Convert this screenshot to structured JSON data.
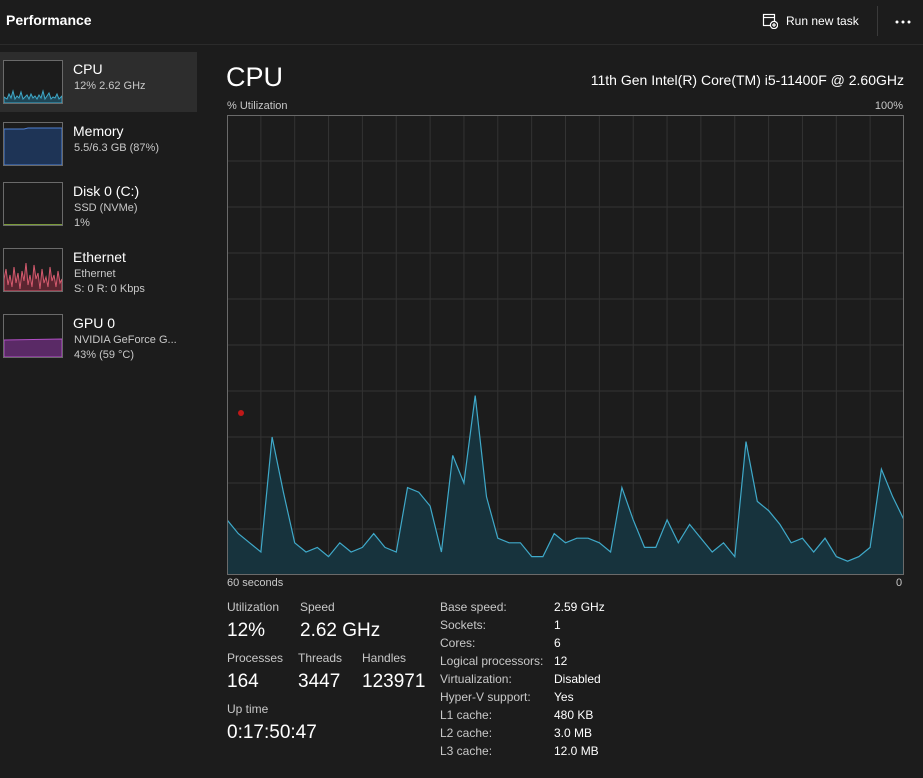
{
  "header": {
    "title": "Performance",
    "run_new_task": "Run new task",
    "more_icon": "ellipsis-icon"
  },
  "sidebar": {
    "items": [
      {
        "name": "CPU",
        "sub1": "12% 2.62 GHz",
        "sub2": "",
        "color": "#3fa9c9"
      },
      {
        "name": "Memory",
        "sub1": "5.5/6.3 GB (87%)",
        "sub2": "",
        "color": "#4f7fd1"
      },
      {
        "name": "Disk 0 (C:)",
        "sub1": "SSD (NVMe)",
        "sub2": "1%",
        "color": "#7a9a3a"
      },
      {
        "name": "Ethernet",
        "sub1": "Ethernet",
        "sub2": "S: 0 R: 0 Kbps",
        "color": "#d45a6e"
      },
      {
        "name": "GPU 0",
        "sub1": "NVIDIA GeForce G...",
        "sub2": "43% (59 °C)",
        "color": "#b04fc4"
      }
    ]
  },
  "main": {
    "title": "CPU",
    "model": "11th Gen Intel(R) Core(TM) i5-11400F @ 2.60GHz",
    "util_label": "% Utilization",
    "util_max": "100%",
    "time_left": "60 seconds",
    "time_right": "0",
    "accent": "#3fa9c9"
  },
  "stats": {
    "utilization_label": "Utilization",
    "utilization": "12%",
    "speed_label": "Speed",
    "speed": "2.62 GHz",
    "processes_label": "Processes",
    "processes": "164",
    "threads_label": "Threads",
    "threads": "3447",
    "handles_label": "Handles",
    "handles": "123971",
    "uptime_label": "Up time",
    "uptime": "0:17:50:47"
  },
  "specs": [
    {
      "label": "Base speed:",
      "value": "2.59 GHz"
    },
    {
      "label": "Sockets:",
      "value": "1"
    },
    {
      "label": "Cores:",
      "value": "6"
    },
    {
      "label": "Logical processors:",
      "value": "12"
    },
    {
      "label": "Virtualization:",
      "value": "Disabled"
    },
    {
      "label": "Hyper-V support:",
      "value": "Yes"
    },
    {
      "label": "L1 cache:",
      "value": "480 KB"
    },
    {
      "label": "L2 cache:",
      "value": "3.0 MB"
    },
    {
      "label": "L3 cache:",
      "value": "12.0 MB"
    }
  ],
  "chart_data": {
    "type": "area",
    "xlim": [
      60,
      0
    ],
    "ylim": [
      0,
      100
    ],
    "x": [
      60,
      59,
      58,
      57,
      56,
      55,
      54,
      53,
      52,
      51,
      50,
      49,
      48,
      47,
      46,
      45,
      44,
      43,
      42,
      41,
      40,
      39,
      38,
      37,
      36,
      35,
      34,
      33,
      32,
      31,
      30,
      29,
      28,
      27,
      26,
      25,
      24,
      23,
      22,
      21,
      20,
      19,
      18,
      17,
      16,
      15,
      14,
      13,
      12,
      11,
      10,
      9,
      8,
      7,
      6,
      5,
      4,
      3,
      2,
      1,
      0
    ],
    "values": [
      12,
      9,
      7,
      5,
      30,
      18,
      7,
      5,
      6,
      4,
      7,
      5,
      6,
      9,
      6,
      5,
      19,
      18,
      15,
      5,
      26,
      20,
      39,
      17,
      8,
      7,
      7,
      4,
      4,
      9,
      7,
      8,
      8,
      7,
      5,
      19,
      12,
      6,
      6,
      12,
      7,
      11,
      8,
      5,
      7,
      4,
      29,
      16,
      14,
      11,
      7,
      8,
      5,
      8,
      4,
      3,
      4,
      6,
      23,
      17,
      12
    ],
    "series": [
      {
        "values": "values",
        "color": "#3fa9c9"
      }
    ]
  }
}
